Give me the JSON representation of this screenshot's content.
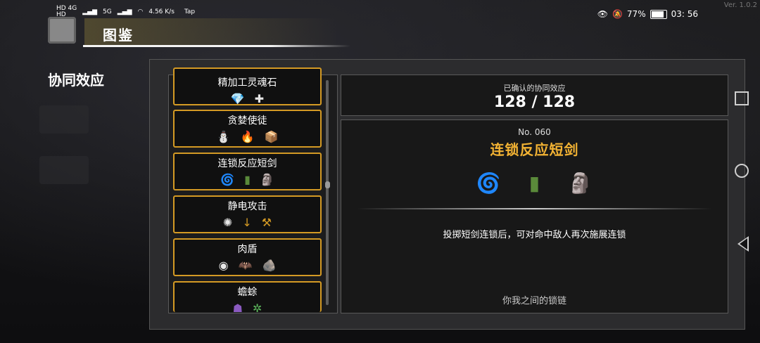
{
  "status_bar": {
    "network_top": "HD 4G",
    "network_bottom": "HD",
    "signal_label": "5G",
    "speed": "4.56 K/s",
    "app": "Tap",
    "battery": "77%",
    "time": "03: 56",
    "version": "Ver. 1.0.2"
  },
  "header": {
    "title": "图鉴"
  },
  "sidebar": {
    "section_label": "协同效应"
  },
  "synergy_list": {
    "items": [
      {
        "name": "精加工灵魂石",
        "icons": [
          "💎",
          "✚"
        ]
      },
      {
        "name": "贪婪使徒",
        "icons": [
          "⛄",
          "🔥",
          "📦"
        ]
      },
      {
        "name": "连锁反应短剑",
        "icons": [
          "🌀",
          "▮",
          "🗿"
        ]
      },
      {
        "name": "静电攻击",
        "icons": [
          "✺",
          "↓",
          "⚒"
        ]
      },
      {
        "name": "肉盾",
        "icons": [
          "◉",
          "🦇",
          "🪨"
        ]
      },
      {
        "name": "蟾蜍",
        "icons": [
          "☗",
          "✲"
        ]
      }
    ]
  },
  "summary": {
    "label": "已确认的协同效应",
    "value": "128 / 128"
  },
  "detail": {
    "number": "No. 060",
    "title": "连锁反应短剑",
    "icons": [
      "🌀",
      "▮",
      "🗿"
    ],
    "description": "投掷短剑连锁后，可对命中敌人再次施展连锁",
    "flavor": "你我之间的锁链"
  },
  "colors": {
    "accent": "#f2b233",
    "item_border": "#d49a24",
    "panel": "#2c2c2e"
  }
}
